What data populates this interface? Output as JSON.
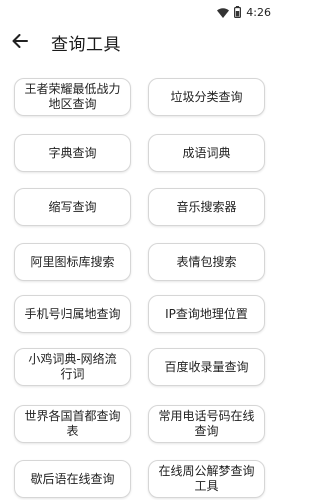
{
  "status_bar": {
    "time": "4:26",
    "icons": [
      "wifi-icon",
      "battery-icon"
    ]
  },
  "header": {
    "back_icon": "arrow-left-icon",
    "title": "查询工具"
  },
  "tools": [
    "王者荣耀最低战力\n地区查询",
    "垃圾分类查询",
    "字典查询",
    "成语词典",
    "缩写查询",
    "音乐搜索器",
    "阿里图标库搜索",
    "表情包搜索",
    "手机号归属地查询",
    "IP查询地理位置",
    "小鸡词典-网络流\n行词",
    "百度收录量查询",
    "世界各国首都查询\n表",
    "常用电话号码在线\n查询",
    "歇后语在线查询",
    "在线周公解梦查询\n工具"
  ]
}
